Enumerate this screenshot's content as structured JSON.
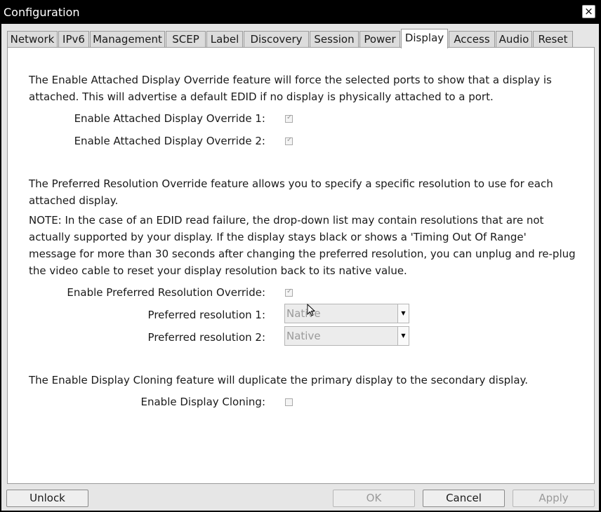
{
  "window": {
    "title": "Configuration",
    "close_glyph": "×"
  },
  "tabs": [
    {
      "label": "Network"
    },
    {
      "label": "IPv6"
    },
    {
      "label": "Management"
    },
    {
      "label": "SCEP"
    },
    {
      "label": "Label"
    },
    {
      "label": "Discovery"
    },
    {
      "label": "Session"
    },
    {
      "label": "Power"
    },
    {
      "label": "Display"
    },
    {
      "label": "Access"
    },
    {
      "label": "Audio"
    },
    {
      "label": "Reset"
    }
  ],
  "active_tab": "Display",
  "attached_override": {
    "description": "The Enable Attached Display Override feature will force the selected ports to show that a display is attached. This will advertise a default EDID if no display is physically attached to a port.",
    "override1_label": "Enable Attached Display Override 1:",
    "override1_checked": true,
    "override2_label": "Enable Attached Display Override 2:",
    "override2_checked": true
  },
  "preferred_resolution": {
    "description": "The Preferred Resolution Override feature allows you to specify a specific resolution to use for each attached display.",
    "note": "NOTE: In the case of an EDID read failure, the drop-down list may contain resolutions that are not actually supported by your display. If the display stays black or shows a 'Timing Out Of Range' message for more than 30 seconds after changing the preferred resolution, you can unplug and re-plug the video cable to reset your display resolution back to its native value.",
    "override_label": "Enable Preferred Resolution Override:",
    "override_checked": true,
    "res1_label": "Preferred resolution 1:",
    "res1_value": "Native",
    "res2_label": "Preferred resolution 2:",
    "res2_value": "Native"
  },
  "cloning": {
    "description": "The Enable Display Cloning feature will duplicate the primary display to the secondary display.",
    "label": "Enable Display Cloning:",
    "checked": false
  },
  "footer": {
    "unlock_label": "Unlock",
    "ok_label": "OK",
    "cancel_label": "Cancel",
    "apply_label": "Apply"
  },
  "glyphs": {
    "check": "✓",
    "dropdown": "▼"
  }
}
